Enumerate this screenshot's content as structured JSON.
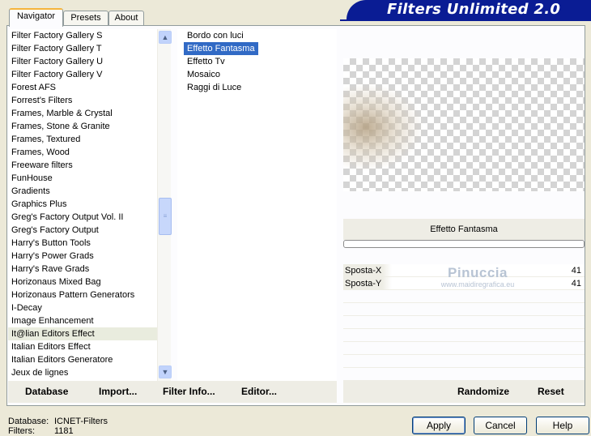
{
  "tabs": [
    {
      "label": "Navigator",
      "active": true
    },
    {
      "label": "Presets",
      "active": false
    },
    {
      "label": "About",
      "active": false
    }
  ],
  "banner": {
    "title": "Filters Unlimited 2.0",
    "color": "#0a1c94"
  },
  "categories": [
    "Filter Factory Gallery S",
    "Filter Factory Gallery T",
    "Filter Factory Gallery U",
    "Filter Factory Gallery V",
    "Forest AFS",
    "Forrest's Filters",
    "Frames, Marble & Crystal",
    "Frames, Stone & Granite",
    "Frames, Textured",
    "Frames, Wood",
    "Freeware filters",
    "FunHouse",
    "Gradients",
    "Graphics Plus",
    "Greg's Factory Output Vol. II",
    "Greg's Factory Output",
    "Harry's Button Tools",
    "Harry's Power Grads",
    "Harry's Rave Grads",
    "Horizonaus Mixed Bag",
    "Horizonaus Pattern Generators",
    "I-Decay",
    "Image Enhancement",
    "It@lian Editors Effect",
    "Italian Editors Effect",
    "Italian Editors Generatore",
    "Jeux de lignes"
  ],
  "selected_category": "It@lian Editors Effect",
  "filters": [
    "Bordo con luci",
    "Effetto Fantasma",
    "Effetto Tv",
    "Mosaico",
    "Raggi di Luce"
  ],
  "selected_filter": "Effetto Fantasma",
  "preview": {
    "filter_name": "Effetto Fantasma"
  },
  "params": [
    {
      "label": "Sposta-X",
      "value": "41"
    },
    {
      "label": "Sposta-Y",
      "value": "41"
    }
  ],
  "watermark": {
    "name": "Pinuccia",
    "url": "www.maidiregrafica.eu"
  },
  "toolbar_left": {
    "database": "Database",
    "import": "Import...",
    "filter_info": "Filter Info...",
    "editor": "Editor..."
  },
  "toolbar_right": {
    "randomize": "Randomize",
    "reset": "Reset"
  },
  "status": {
    "database_label": "Database:",
    "database_value": "ICNET-Filters",
    "filters_label": "Filters:",
    "filters_value": "1181"
  },
  "buttons": {
    "apply": "Apply",
    "cancel": "Cancel",
    "help": "Help"
  },
  "colors": {
    "selection": "#316ac5",
    "window_bg": "#ece9d8"
  }
}
